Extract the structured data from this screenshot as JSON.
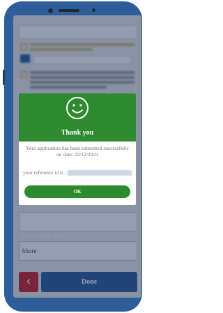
{
  "dialog": {
    "title": "Thank you",
    "message": "Your application has been submitted successfully on date: 22/12/2023",
    "reference_label": "your reference id is :",
    "ok_label": "OK"
  },
  "form": {
    "place_label": "Place of Application *",
    "place_value": "bhore",
    "done_label": "Done",
    "back_icon": "chevron-left-icon"
  },
  "colors": {
    "accent_green": "#2e8a2e",
    "done_blue": "#2c5e9c",
    "back_red": "#cc1f2c",
    "frame_blue": "#2e5e9a"
  }
}
